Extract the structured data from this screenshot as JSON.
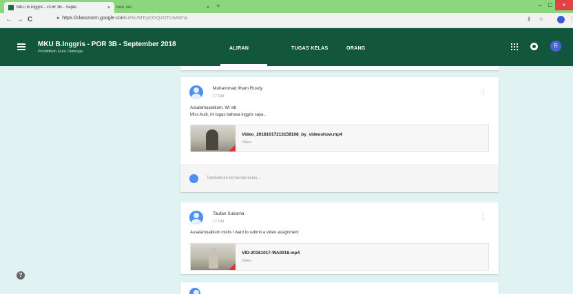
{
  "browser": {
    "tabs": [
      {
        "title": "MKU B.Inggris - POR 3B - Septe",
        "close": "×"
      },
      {
        "title": "New Tab",
        "close": "×"
      }
    ],
    "new_tab": "+",
    "window_controls": {
      "minimize": "–",
      "maximize": "□",
      "close": "×"
    },
    "nav": {
      "back": "←",
      "forward": "→",
      "reload": "C"
    },
    "url_host": "https://classroom.google.com",
    "url_path": "/u/0/c/MTcyODQzOTUwNzha",
    "toolbar_icons": {
      "key": "⚷",
      "star": "☆",
      "menu": "⋮"
    }
  },
  "header": {
    "class_title": "MKU B.Inggris - POR 3B - September 2018",
    "class_subtitle": "Pendidikan Guru Olahraga",
    "tabs": [
      "ALIRAN",
      "TUGAS KELAS",
      "ORANG"
    ],
    "avatar_letter": "R",
    "colors": {
      "header_bg": "#12573d",
      "page_bg": "#e0f3f2",
      "avatar": "#4a62d8"
    }
  },
  "posts": [
    {
      "author": "Muhammad Ilham Rusdy",
      "date": "17 Okt",
      "lines": [
        "Assalamualaikum, Wr wb",
        "Miss Audi, ini tugas bahasa inggris saya.."
      ],
      "attachment": {
        "name": "Video_20181017213158108_by_videoshow.mp4",
        "type": "Video"
      },
      "comment_placeholder": "Tambahkan komentar kelas..."
    },
    {
      "author": "Taufan Sukarna",
      "date": "17 Okt",
      "lines": [
        "Assalamualikum mislis I want to submit a video assignment"
      ],
      "attachment": {
        "name": "VID-20181017-WA0018.mp4",
        "type": "Video"
      }
    }
  ],
  "help": "?"
}
